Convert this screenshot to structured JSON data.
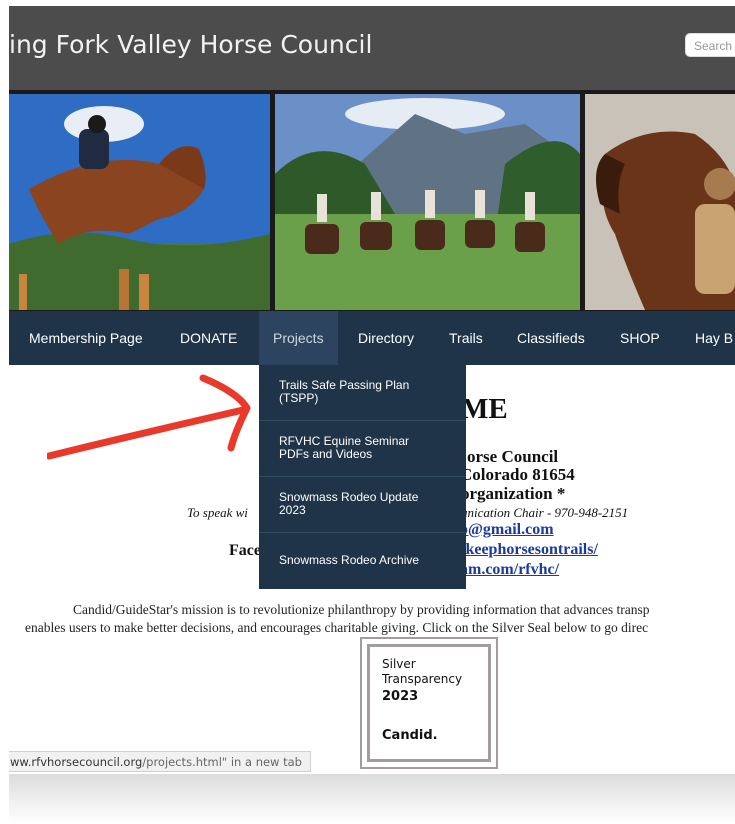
{
  "header": {
    "site_title": "ing Fork Valley Horse Council",
    "search_placeholder": "Search"
  },
  "nav": {
    "items": [
      "Membership Page",
      "DONATE",
      "Projects",
      "Directory",
      "Trails",
      "Classifieds",
      "SHOP",
      "Hay B"
    ],
    "active": "Projects"
  },
  "dropdown": {
    "items": [
      [
        "Trails Safe Passing Plan",
        "(TSPP)"
      ],
      [
        "RFVHC Equine Seminar",
        "PDFs and Videos"
      ],
      [
        "Snowmass Rodeo Update",
        "2023"
      ],
      [
        "Snowmass Rodeo Archive"
      ]
    ]
  },
  "content": {
    "welcome": "ME",
    "line1": "orse Council",
    "line2": "Colorado 81654",
    "line3": "organization *",
    "speak_prefix": "To speak wi",
    "speak_suffix": "unication Chair -  970-948-2151",
    "email": "o@gmail.com",
    "fb_prefix": "Face",
    "fb_link": "/keephorsesontrails/",
    "insta_link": "am.com/rfvhc/",
    "mission_line1": "Candid/GuideStar's mission is to revolutionize philanthropy by providing information that advances transp",
    "mission_line2": "enables users to make better decisions, and encourages charitable giving. Click on the Silver Seal below to go direc"
  },
  "seal": {
    "line1": "Silver",
    "line2": "Transparency",
    "year": "2023",
    "brand": "Candid."
  },
  "status_bar": {
    "text_prefix": "ww.rfvhorsecouncil.org",
    "text_path": "/projects.html\" in a new tab"
  },
  "colors": {
    "header_bg": "#4c4c4c",
    "nav_bg": "#1f3448",
    "link": "#1c3a9e",
    "arrow": "#e8392a"
  }
}
